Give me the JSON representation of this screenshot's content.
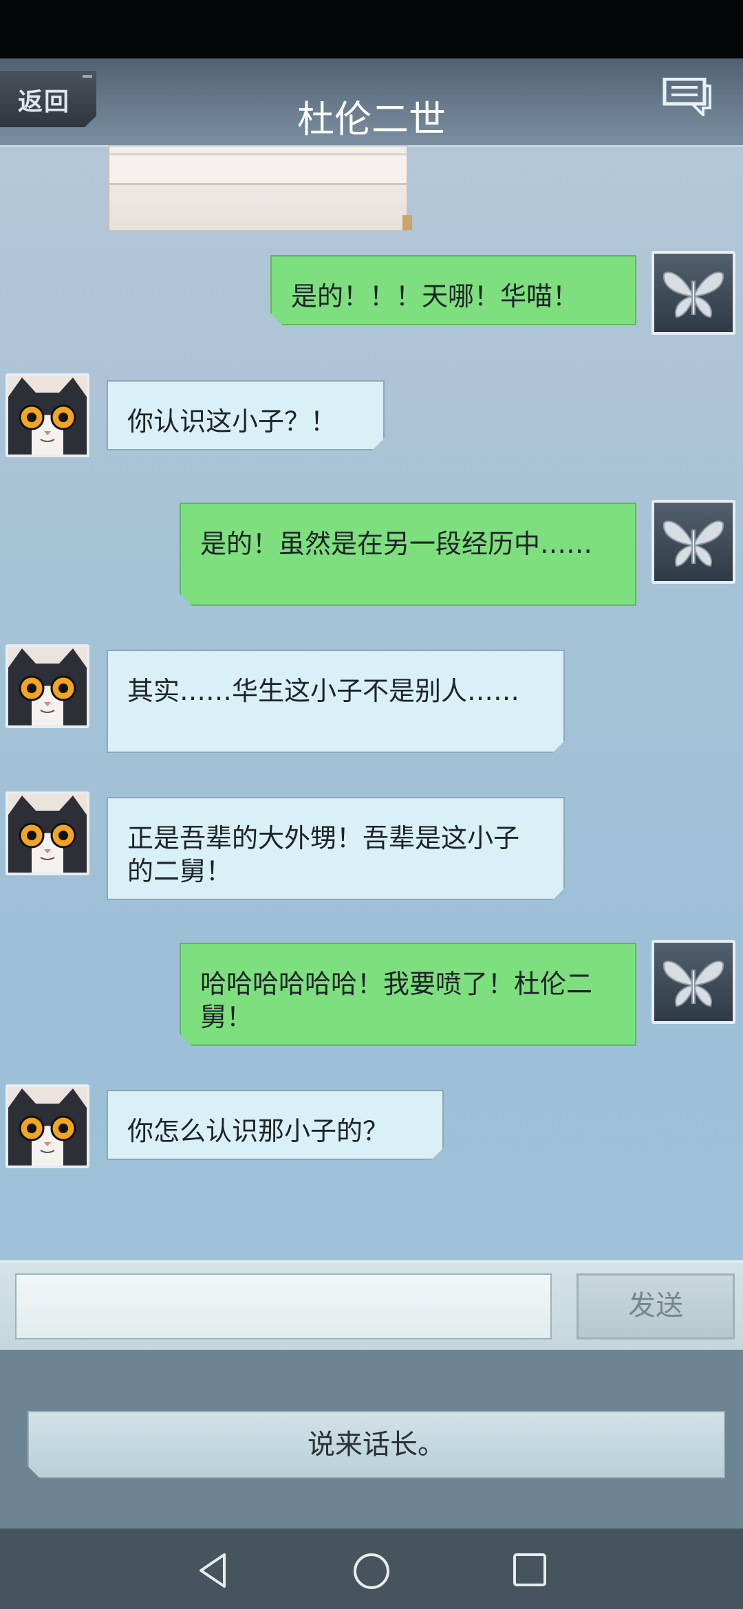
{
  "header": {
    "back_label": "返回",
    "title": "杜伦二世"
  },
  "icons": {
    "back": "back-button",
    "messages": "message-icon",
    "avatar_self": "butterfly-icon",
    "avatar_other": "cat-icon"
  },
  "messages": [
    {
      "side": "right",
      "text": "是的！！！天哪！华喵！"
    },
    {
      "side": "left",
      "text": "你认识这小子？！"
    },
    {
      "side": "right",
      "text": "是的！虽然是在另一段经历中……"
    },
    {
      "side": "left",
      "text": "其实……华生这小子不是别人……"
    },
    {
      "side": "left",
      "text": "正是吾辈的大外甥！吾辈是这小子的二舅！"
    },
    {
      "side": "right",
      "text": "哈哈哈哈哈哈！我要喷了！杜伦二舅！"
    },
    {
      "side": "left",
      "text": "你怎么认识那小子的？"
    }
  ],
  "input": {
    "value": "",
    "send_label": "发送"
  },
  "reply_option": "说来话长。",
  "colors": {
    "right_bubble": "#7ddf7d",
    "left_bubble": "#daf0f7",
    "header": "#5f7284"
  }
}
